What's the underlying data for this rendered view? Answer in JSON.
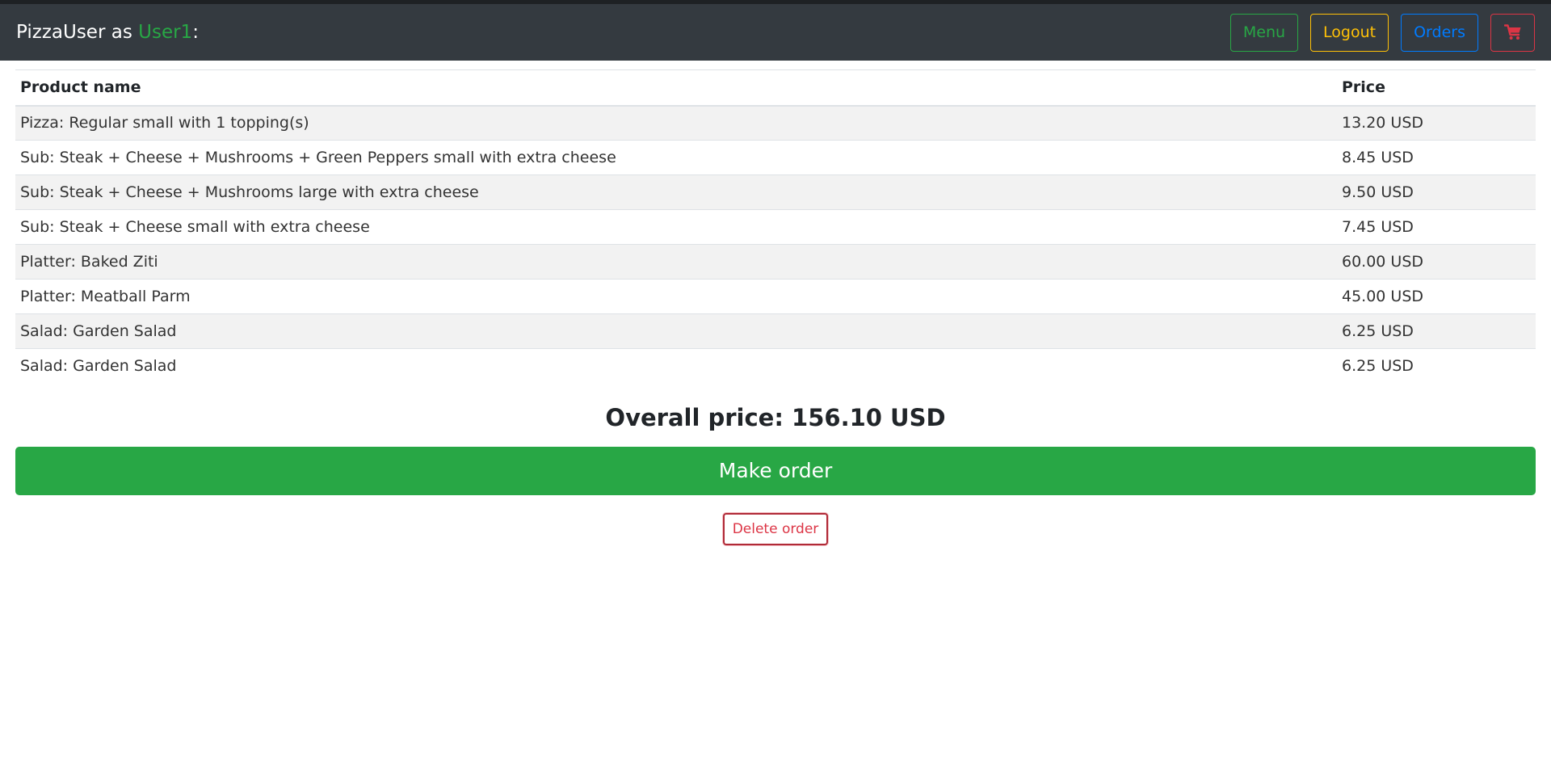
{
  "navbar": {
    "brand_name": "PizzaUser",
    "brand_as": " as ",
    "username": "User1",
    "brand_suffix": ":",
    "menu_label": "Menu",
    "logout_label": "Logout",
    "orders_label": "Orders",
    "cart_icon": "shopping-cart-icon"
  },
  "colors": {
    "navbar_bg": "#343a40",
    "success": "#28a745",
    "warning": "#ffc107",
    "primary": "#007bff",
    "danger": "#dc3545"
  },
  "table": {
    "headers": {
      "product": "Product name",
      "price": "Price"
    },
    "rows": [
      {
        "product": "Pizza: Regular small with 1 topping(s)",
        "price": "13.20 USD"
      },
      {
        "product": "Sub: Steak + Cheese + Mushrooms + Green Peppers small with extra cheese",
        "price": "8.45 USD"
      },
      {
        "product": "Sub: Steak + Cheese + Mushrooms large with extra cheese",
        "price": "9.50 USD"
      },
      {
        "product": "Sub: Steak + Cheese small with extra cheese",
        "price": "7.45 USD"
      },
      {
        "product": "Platter: Baked Ziti",
        "price": "60.00 USD"
      },
      {
        "product": "Platter: Meatball Parm",
        "price": "45.00 USD"
      },
      {
        "product": "Salad: Garden Salad",
        "price": "6.25 USD"
      },
      {
        "product": "Salad: Garden Salad",
        "price": "6.25 USD"
      }
    ]
  },
  "summary": {
    "overall_price": "Overall price: 156.10 USD"
  },
  "actions": {
    "make_order_label": "Make order",
    "delete_order_label": "Delete order"
  }
}
